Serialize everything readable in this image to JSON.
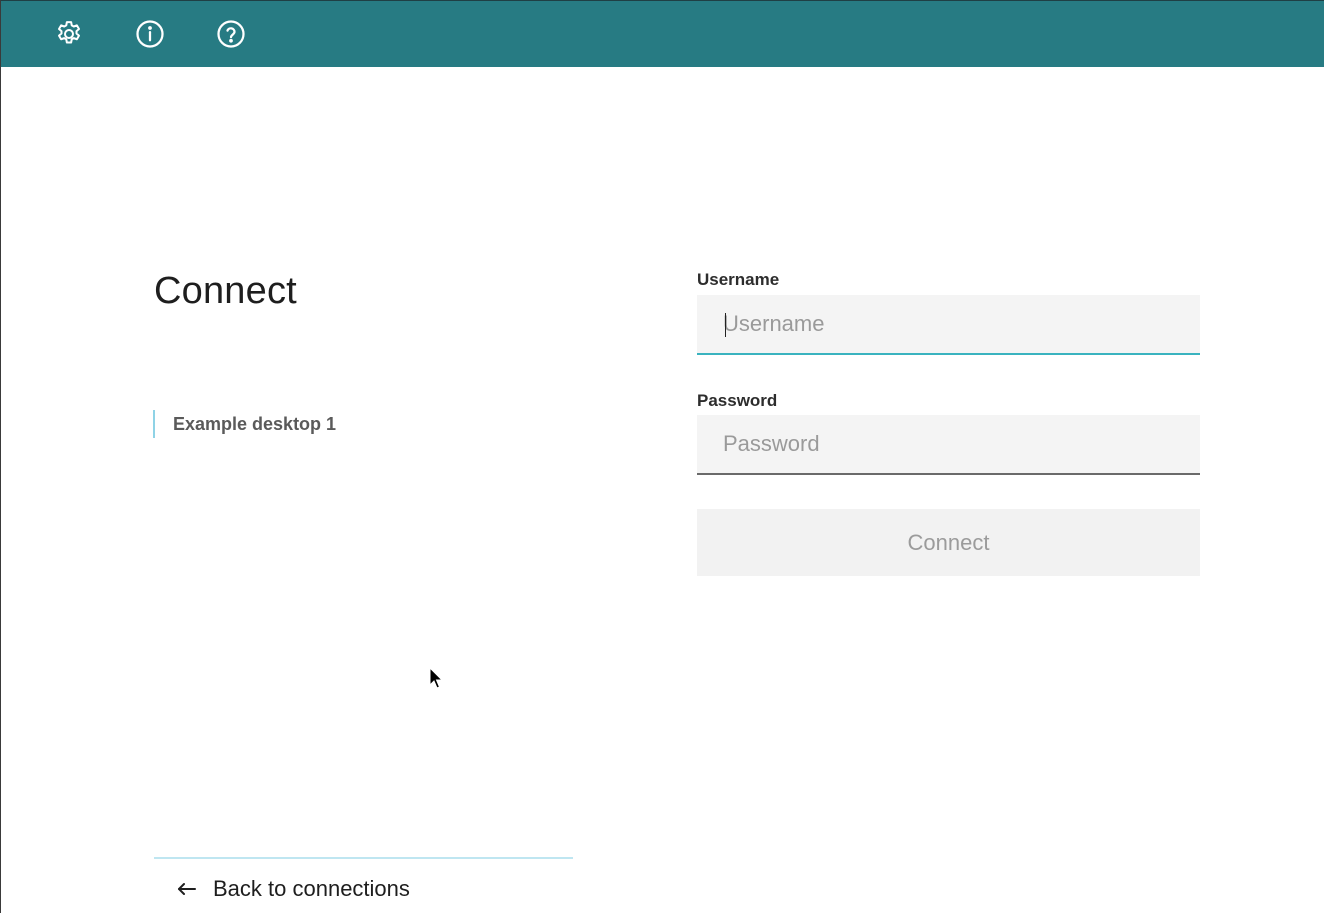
{
  "topbar": {
    "background": "#277b83",
    "icons": [
      {
        "name": "settings-icon",
        "glyph": "gear"
      },
      {
        "name": "info-icon",
        "glyph": "info-circle"
      },
      {
        "name": "help-icon",
        "glyph": "question-circle"
      }
    ]
  },
  "main": {
    "title": "Connect",
    "connection_name": "Example desktop 1"
  },
  "form": {
    "username_label": "Username",
    "username_placeholder": "Username",
    "username_value": "",
    "password_label": "Password",
    "password_placeholder": "Password",
    "password_value": "",
    "connect_label": "Connect"
  },
  "footer": {
    "back_label": "Back to connections",
    "back_icon": "arrow-left-icon"
  }
}
